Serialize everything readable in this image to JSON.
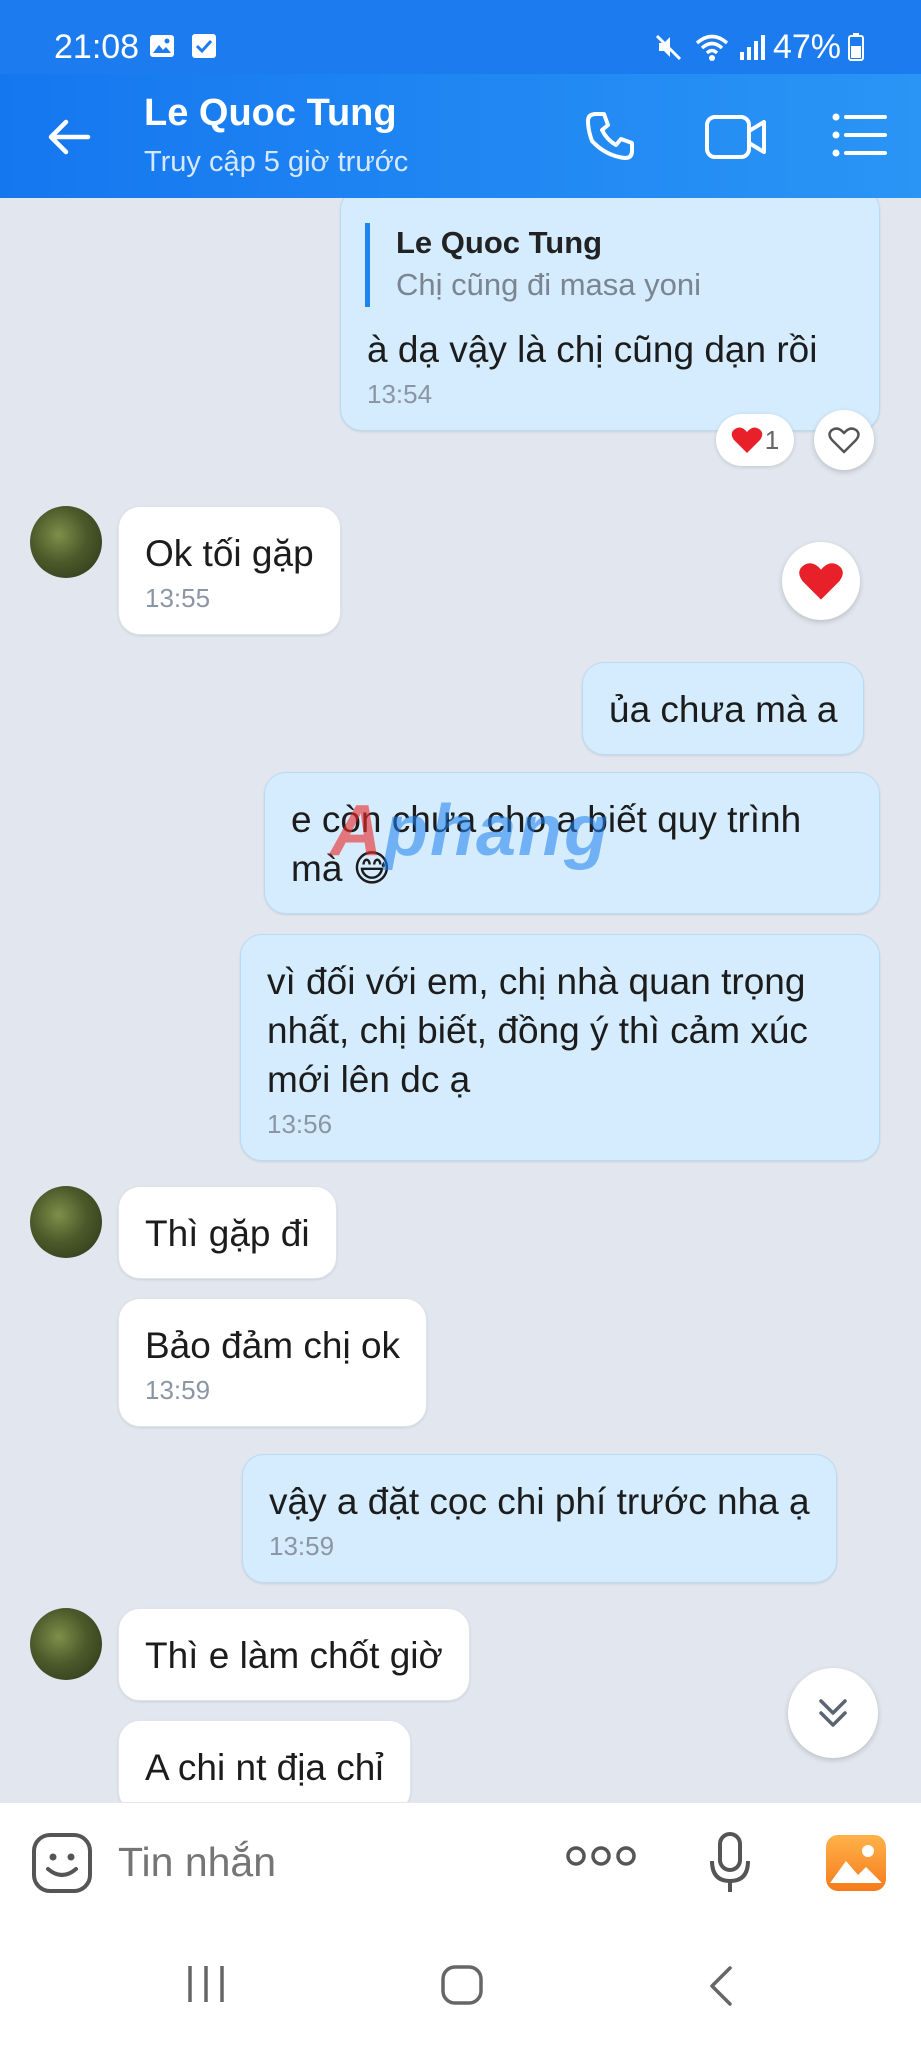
{
  "status_bar": {
    "time": "21:08",
    "battery": "47%"
  },
  "header": {
    "contact_name": "Le Quoc Tung",
    "last_seen": "Truy cập 5 giờ trước"
  },
  "messages": {
    "m1": {
      "quote_name": "Le Quoc Tung",
      "quote_text": "Chị cũng đi masa yoni",
      "text": "à dạ vậy là chị cũng dạn rồi",
      "time": "13:54",
      "reaction_count": "1"
    },
    "m2": {
      "text": "Ok tối gặp",
      "time": "13:55"
    },
    "m3": {
      "text": "ủa chưa mà a"
    },
    "m4": {
      "text": "e còn chưa cho a biết quy trình mà 😅"
    },
    "m5": {
      "text": "vì đối với em, chị nhà quan trọng nhất, chị biết, đồng ý thì cảm xúc mới lên dc ạ",
      "time": "13:56"
    },
    "m6": {
      "text": "Thì gặp đi"
    },
    "m7": {
      "text": "Bảo đảm chị ok",
      "time": "13:59"
    },
    "m8": {
      "text": "vậy a đặt cọc chi phí trước nha ạ",
      "time": "13:59"
    },
    "m9": {
      "text": "Thì e làm chốt giờ"
    },
    "m10": {
      "text": "A chi nt địa chỉ"
    }
  },
  "watermark": {
    "a": "A",
    "rest": "phang"
  },
  "input": {
    "placeholder": "Tin nhắn"
  },
  "colors": {
    "header": "#1c7cef",
    "mine_bubble": "#d4ecfd",
    "theirs_bubble": "#ffffff",
    "heart": "#e8202a"
  }
}
